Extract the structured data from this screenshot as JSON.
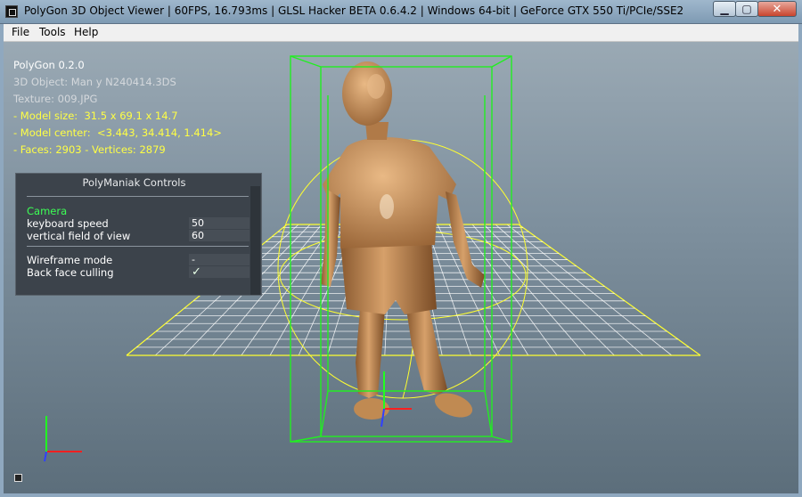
{
  "window": {
    "title": "PolyGon 3D Object Viewer | 60FPS, 16.793ms | GLSL Hacker BETA 0.6.4.2 | Windows 64-bit | GeForce GTX 550 Ti/PCIe/SSE2",
    "minimize_glyph": "▁",
    "maximize_glyph": "▢",
    "close_glyph": "✕"
  },
  "menu": {
    "items": [
      "File",
      "Tools",
      "Help"
    ]
  },
  "info": {
    "app_name": "PolyGon 0.2.0",
    "object": "3D Object: Man y N240414.3DS",
    "texture": "Texture: 009.JPG",
    "model_size": "- Model size:  31.5 x 69.1 x 14.7",
    "model_center": "- Model center:  <3.443, 34.414, 1.414>",
    "faces_vertices": "- Faces: 2903 - Vertices: 2879"
  },
  "controls": {
    "title": "PolyManiak Controls",
    "section_camera": "Camera",
    "keyboard_speed_label": "keyboard speed",
    "keyboard_speed_value": "50",
    "fov_label": "vertical field of view",
    "fov_value": "60",
    "wireframe_label": "Wireframe mode",
    "wireframe_value": "-",
    "backface_label": "Back face culling",
    "backface_value": "✓"
  },
  "colors": {
    "grid": "#ffffff",
    "grid_border": "#ffff30",
    "bounding_box": "#22ee22",
    "bounding_sphere": "#ffff30",
    "axis_x": "#ff2020",
    "axis_y": "#20ff20",
    "axis_z": "#3040ff",
    "figure": "#c08a52"
  },
  "icons": {
    "app_icon": "polygon-app-icon",
    "status_icon": "small-square-icon"
  }
}
